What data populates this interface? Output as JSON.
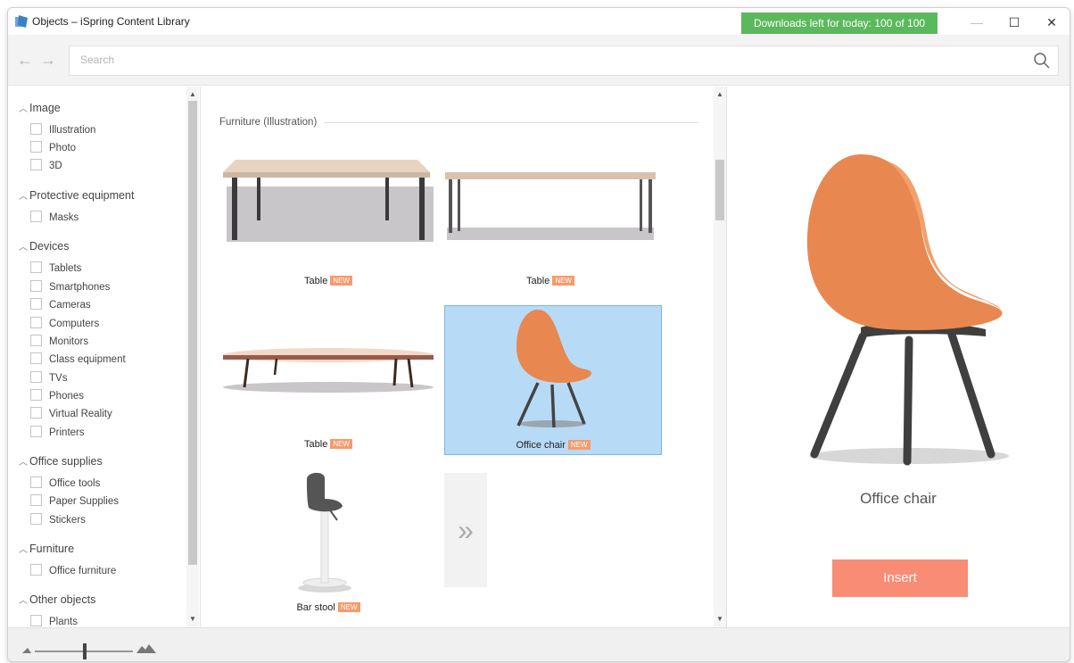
{
  "window": {
    "title": "Objects – iSpring Content Library",
    "downloads": "Downloads left for today: 100 of 100",
    "minimize": "—",
    "maximize": "☐",
    "close": "✕"
  },
  "toolbar": {
    "back": "←",
    "forward": "→",
    "search_placeholder": "Search"
  },
  "sidebar": {
    "categories": [
      {
        "label": "Image",
        "items": [
          "Illustration",
          "Photo",
          "3D"
        ]
      },
      {
        "label": "Protective equipment",
        "items": [
          "Masks"
        ]
      },
      {
        "label": "Devices",
        "items": [
          "Tablets",
          "Smartphones",
          "Cameras",
          "Computers",
          "Monitors",
          "Class equipment",
          "TVs",
          "Phones",
          "Virtual Reality",
          "Printers"
        ]
      },
      {
        "label": "Office supplies",
        "items": [
          "Office tools",
          "Paper Supplies",
          "Stickers"
        ]
      },
      {
        "label": "Furniture",
        "items": [
          "Office furniture"
        ]
      },
      {
        "label": "Other objects",
        "items": [
          "Plants"
        ]
      }
    ]
  },
  "main": {
    "section_title": "Furniture (Illustration)",
    "new_badge": "NEW",
    "tiles": [
      {
        "label": "Table",
        "icon": "table-icon"
      },
      {
        "label": "Table",
        "icon": "table-icon"
      },
      {
        "label": "Table",
        "icon": "oval-table-icon"
      },
      {
        "label": "Office chair",
        "icon": "office-chair-icon"
      },
      {
        "label": "Bar stool",
        "icon": "bar-stool-icon"
      }
    ],
    "more": "»"
  },
  "preview": {
    "name": "Office chair",
    "insert_label": "Insert"
  },
  "colors": {
    "downloads": "#5cb85c",
    "insert": "#f98c74",
    "selected_tile": "#b7dbf6",
    "new_badge": "#f79a6d",
    "chair": "#e8874f"
  }
}
